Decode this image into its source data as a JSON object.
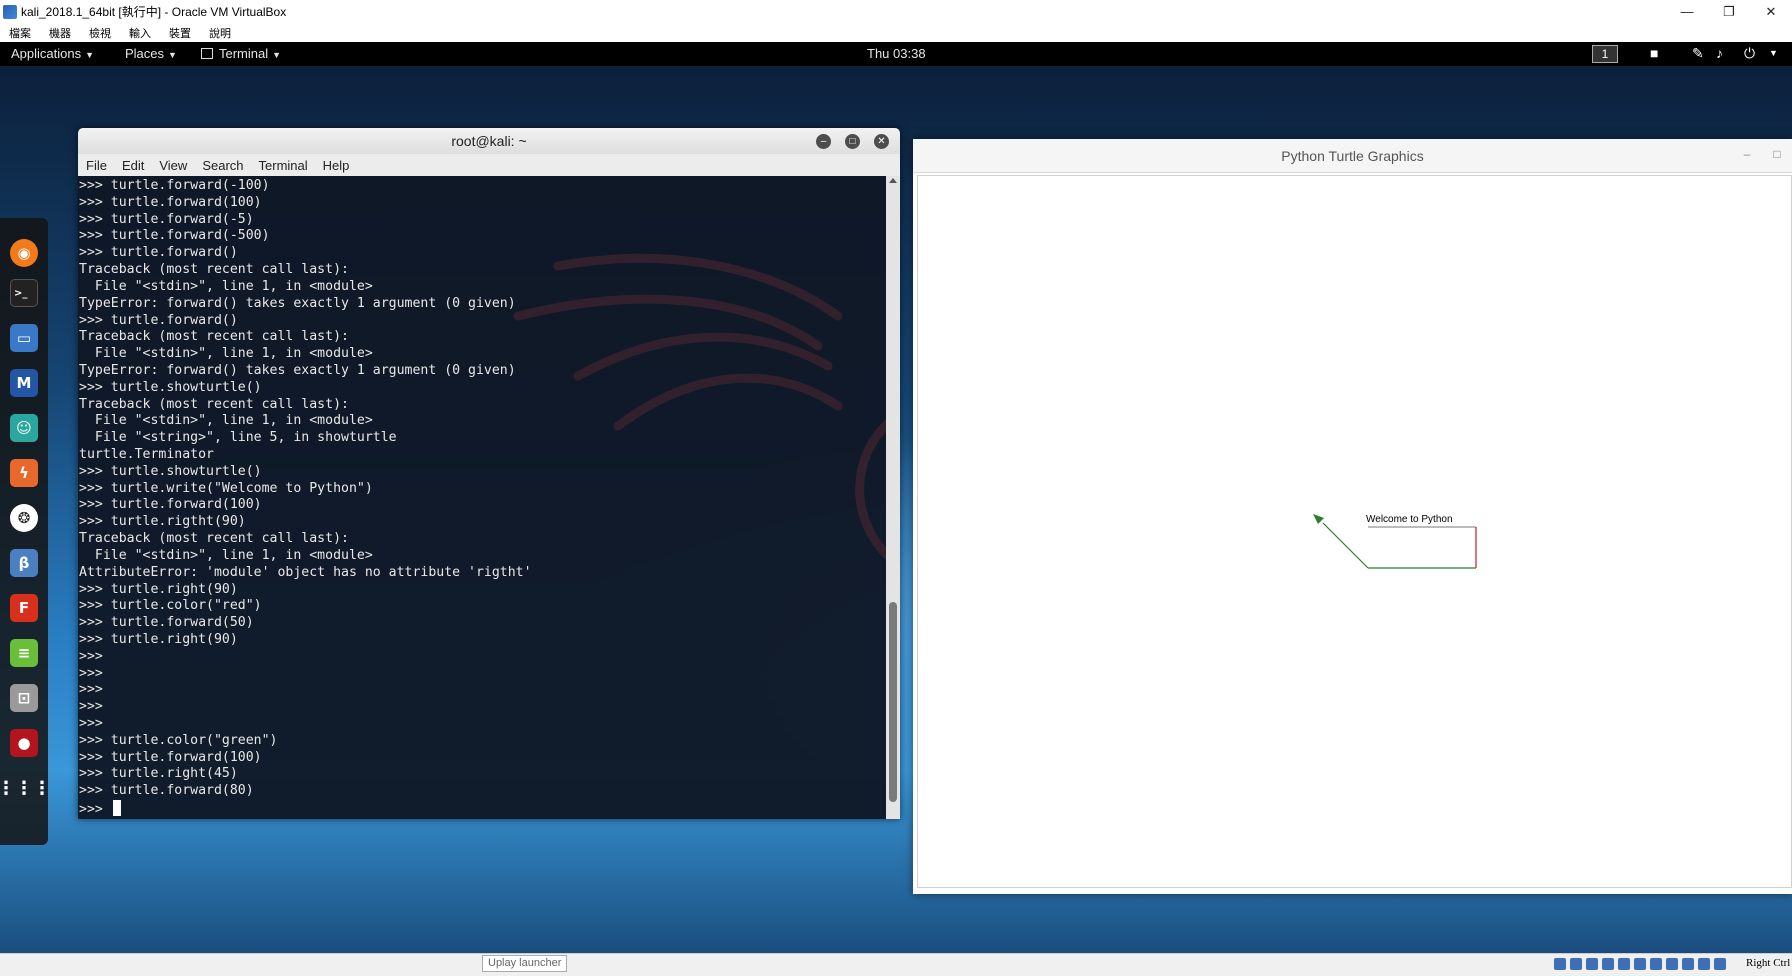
{
  "host_window": {
    "title": "kali_2018.1_64bit [執行中] - Oracle VM VirtualBox",
    "controls": {
      "minimize": "—",
      "restore": "❐",
      "close": "✕"
    },
    "menu": [
      "檔案",
      "機器",
      "檢視",
      "輸入",
      "裝置",
      "說明"
    ]
  },
  "topbar": {
    "applications": "Applications",
    "places": "Places",
    "terminal": "Terminal",
    "clock": "Thu 03:38",
    "workspace": "1",
    "icons": [
      "video-icon",
      "pen-icon",
      "volume-icon",
      "power-icon"
    ]
  },
  "dock": {
    "icons": [
      "firefox-icon",
      "terminal-icon",
      "files-icon",
      "metasploit-icon",
      "armitage-icon",
      "burpsuite-icon",
      "maltego-icon",
      "beef-icon",
      "faraday-icon",
      "leafpad-icon",
      "cutycapt-icon",
      "recordmydesktop-icon",
      "show-apps-icon"
    ]
  },
  "terminal": {
    "title": "root@kali: ~",
    "menu": [
      "File",
      "Edit",
      "View",
      "Search",
      "Terminal",
      "Help"
    ],
    "lines": [
      ">>> turtle.forward(-100)",
      ">>> turtle.forward(100)",
      ">>> turtle.forward(-5)",
      ">>> turtle.forward(-500)",
      ">>> turtle.forward()",
      "Traceback (most recent call last):",
      "  File \"<stdin>\", line 1, in <module>",
      "TypeError: forward() takes exactly 1 argument (0 given)",
      ">>> turtle.forward()",
      "Traceback (most recent call last):",
      "  File \"<stdin>\", line 1, in <module>",
      "TypeError: forward() takes exactly 1 argument (0 given)",
      ">>> turtle.showturtle()",
      "Traceback (most recent call last):",
      "  File \"<stdin>\", line 1, in <module>",
      "  File \"<string>\", line 5, in showturtle",
      "turtle.Terminator",
      ">>> turtle.showturtle()",
      ">>> turtle.write(\"Welcome to Python\")",
      ">>> turtle.forward(100)",
      ">>> turtle.rigtht(90)",
      "Traceback (most recent call last):",
      "  File \"<stdin>\", line 1, in <module>",
      "AttributeError: 'module' object has no attribute 'rigtht'",
      ">>> turtle.right(90)",
      ">>> turtle.color(\"red\")",
      ">>> turtle.forward(50)",
      ">>> turtle.right(90)",
      ">>>",
      ">>>",
      ">>>",
      ">>>",
      ">>>",
      ">>> turtle.color(\"green\")",
      ">>> turtle.forward(100)",
      ">>> turtle.right(45)",
      ">>> turtle.forward(80)"
    ],
    "prompt": ">>> "
  },
  "turtle_window": {
    "title": "Python Turtle Graphics",
    "written_text": "Welcome to Python",
    "colors": {
      "first_stroke": "#c81e1e",
      "second_stroke": "#2e7d2e"
    }
  },
  "statusbar": {
    "tooltip": "Uplay launcher",
    "host_key": "Right Ctrl"
  }
}
